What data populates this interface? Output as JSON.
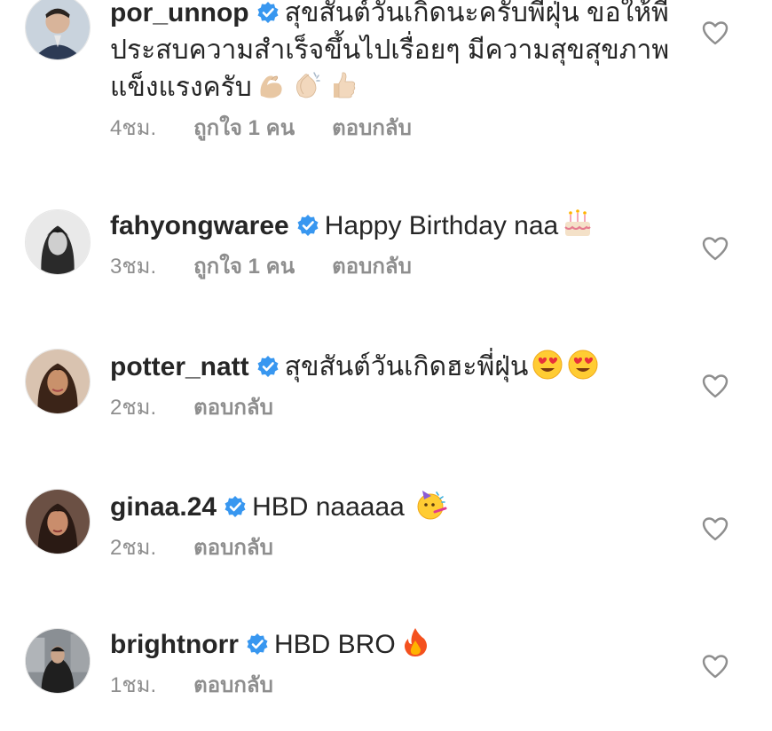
{
  "comments": [
    {
      "username": "por_unnop",
      "text": "สุขสันต์วันเกิดนะครับพี่ฝุ่น ขอให้พี่ประสบความสำเร็จขึ้นไปเรื่อยๆ มีความสุขสุขภาพแข็งแรงครับ",
      "emojis": [
        "flexed-biceps",
        "clapping-hands",
        "thumbs-up"
      ],
      "time": "4ชม.",
      "likes": "ถูกใจ 1 คน",
      "reply": "ตอบกลับ"
    },
    {
      "username": "fahyongwaree",
      "text": "Happy Birthday naa",
      "emojis": [
        "birthday-cake"
      ],
      "time": "3ชม.",
      "likes": "ถูกใจ 1 คน",
      "reply": "ตอบกลับ"
    },
    {
      "username": "potter_natt",
      "text": "สุขสันต์วันเกิดฮะพี่ฝุ่น",
      "emojis": [
        "heart-eyes",
        "heart-eyes"
      ],
      "time": "2ชม.",
      "reply": "ตอบกลับ"
    },
    {
      "username": "ginaa.24",
      "text": "HBD naaaaa",
      "emojis": [
        "partying-face"
      ],
      "time": "2ชม.",
      "reply": "ตอบกลับ"
    },
    {
      "username": "brightnorr",
      "text": "HBD BRO",
      "emojis": [
        "fire"
      ],
      "time": "1ชม.",
      "reply": "ตอบกลับ"
    }
  ],
  "colors": {
    "text": "#262626",
    "meta": "#8e8e8e",
    "verified": "#3897f0",
    "heart_outline": "#8e8e8e"
  }
}
